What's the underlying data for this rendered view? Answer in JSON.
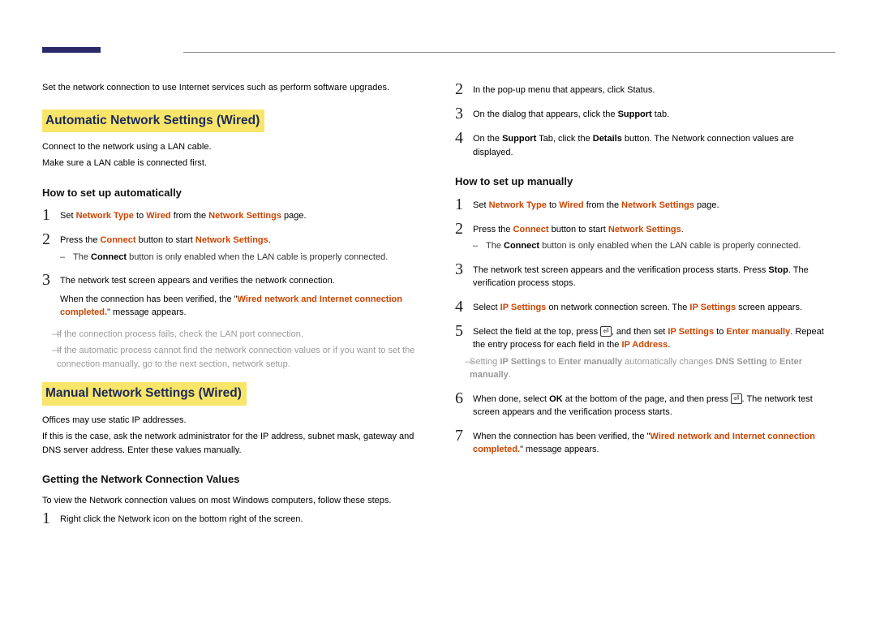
{
  "left": {
    "intro": "Set the network connection to use Internet services such as perform software upgrades.",
    "sec1_title": "Automatic Network Settings (Wired)",
    "sec1_p1": "Connect to the network using a LAN cable.",
    "sec1_p2": "Make sure a LAN cable is connected first.",
    "sec1_sub": "How to set up automatically",
    "s1": {
      "pre": "Set ",
      "nt": "Network Type",
      "mid": " to ",
      "wired": "Wired",
      "mid2": " from the ",
      "ns": "Network Settings",
      "post": " page."
    },
    "s2": {
      "pre": "Press the ",
      "connect": "Connect",
      "mid": " button to start ",
      "ns": "Network Settings",
      "post": "."
    },
    "s2_dash": {
      "pre": "The ",
      "connect": "Connect",
      "post": " button is only enabled when the LAN cable is properly connected."
    },
    "s3_l1": "The network test screen appears and verifies the network connection.",
    "s3_l2a": "When the connection has been verified, the \"",
    "s3_l2b": "Wired network and Internet connection completed.",
    "s3_l2c": "\" message appears.",
    "grey1": "If the connection process fails, check the LAN port connection.",
    "grey2": "If the automatic process cannot find the network connection values or if you want to set the connection manually, go to the next section, network setup.",
    "sec2_title": "Manual Network Settings (Wired)",
    "sec2_p1": "Offices may use static IP addresses.",
    "sec2_p2": "If this is the case, ask the network administrator for the IP address, subnet mask, gateway and DNS server address. Enter these values manually.",
    "sec2_sub": "Getting the Network Connection Values",
    "sec2_intro": "To view the Network connection values on most Windows computers, follow these steps.",
    "gs1": "Right click the Network icon on the bottom right of the screen."
  },
  "right": {
    "s2": "In the pop-up menu that appears, click Status.",
    "s3": {
      "pre": "On the dialog that appears, click the ",
      "support": "Support",
      "post": " tab."
    },
    "s4": {
      "pre": "On the ",
      "support": "Support",
      "mid": " Tab, click the ",
      "details": "Details",
      "post": " button. The Network connection values are displayed."
    },
    "sub": "How to set up manually",
    "m1": {
      "pre": "Set ",
      "nt": "Network Type",
      "mid": " to ",
      "wired": "Wired",
      "mid2": " from the ",
      "ns": "Network Settings",
      "post": " page."
    },
    "m2": {
      "pre": "Press the ",
      "connect": "Connect",
      "mid": " button to start ",
      "ns": "Network Settings",
      "post": "."
    },
    "m2_dash": {
      "pre": "The ",
      "connect": "Connect",
      "post": " button is only enabled when the LAN cable is properly connected."
    },
    "m3": {
      "pre": "The network test screen appears and the verification process starts. Press ",
      "stop": "Stop",
      "post": ". The verification process stops."
    },
    "m4": {
      "pre": "Select ",
      "ips": "IP Settings",
      "mid": " on network connection screen. The ",
      "ips2": "IP Settings",
      "post": " screen appears."
    },
    "m5": {
      "pre": "Select the field at the top, press ",
      "mid1": ", and then set ",
      "ips": "IP Settings",
      "mid2": " to ",
      "em": "Enter manually",
      "mid3": ". Repeat the entry process for each field in the ",
      "ipaddr": "IP Address",
      "post": "."
    },
    "m5_grey": {
      "pre": "Setting ",
      "ips": "IP Settings",
      "mid1": " to ",
      "em": "Enter manually",
      "mid2": " automatically changes ",
      "dns": "DNS Setting",
      "mid3": " to ",
      "em2": "Enter manually",
      "post": "."
    },
    "m6": {
      "pre": "When done, select ",
      "ok": "OK",
      "mid": " at the bottom of the page, and then press ",
      "post": ". The network test screen appears and the verification process starts."
    },
    "m7": {
      "pre": "When the connection has been verified, the \"",
      "hl": "Wired network and Internet connection completed.",
      "post": "\" message appears."
    }
  }
}
